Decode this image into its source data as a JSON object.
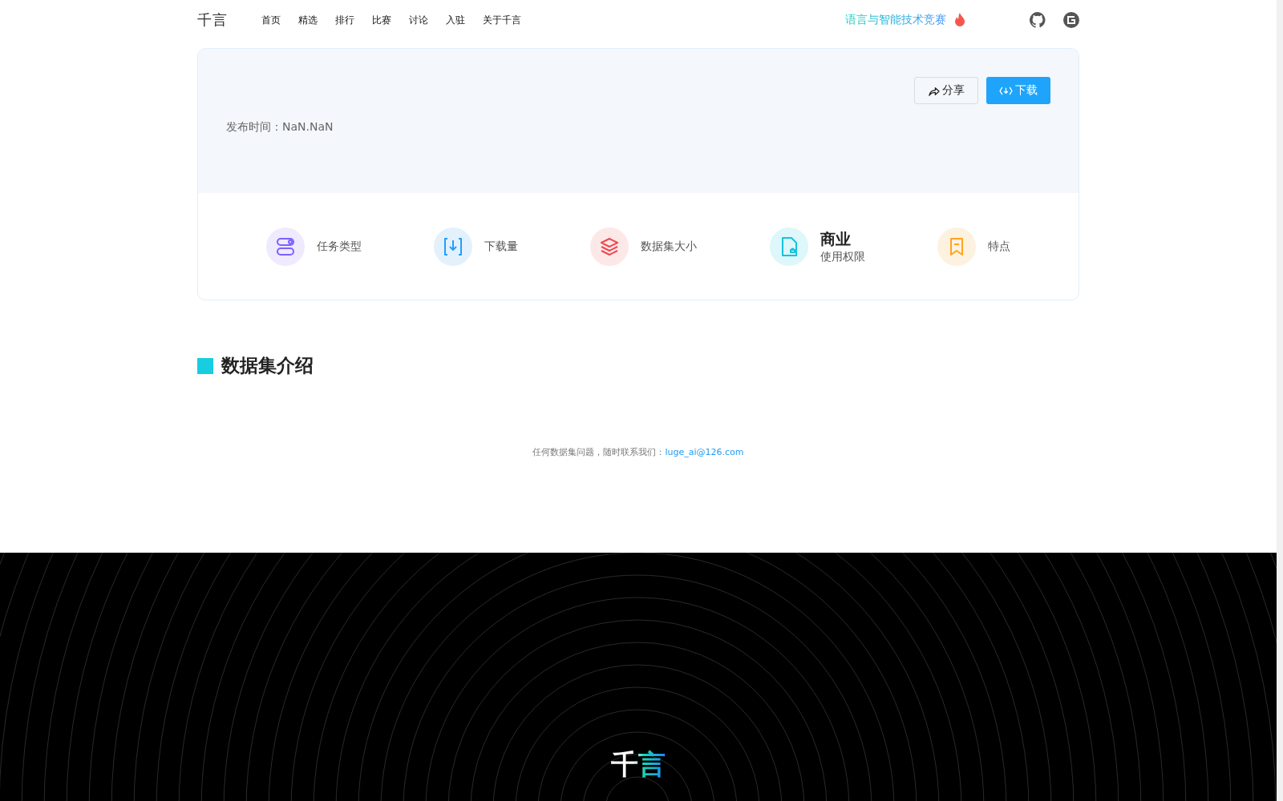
{
  "nav": {
    "logo": "千言",
    "links": [
      {
        "label": "首页"
      },
      {
        "label": "精选"
      },
      {
        "label": "排行"
      },
      {
        "label": "比赛"
      },
      {
        "label": "讨论"
      },
      {
        "label": "入驻"
      },
      {
        "label": "关于千言"
      }
    ],
    "promo": "语言与智能技术竞赛"
  },
  "header": {
    "publish": "发布时间：NaN.NaN",
    "buttons": [
      {
        "kind": "share",
        "label": "分享"
      },
      {
        "kind": "download",
        "label": "下载"
      }
    ]
  },
  "stats": [
    {
      "kind": "task",
      "label": "任务类型"
    },
    {
      "kind": "download",
      "label": "下载量"
    },
    {
      "kind": "size",
      "label": "数据集大小"
    },
    {
      "kind": "license",
      "title": "商业",
      "label": "使用权限"
    },
    {
      "kind": "feature",
      "label": "特点"
    }
  ],
  "section": {
    "title": "数据集介绍"
  },
  "contact": {
    "text": "任何数据集问题，随时联系我们：",
    "email": "luge_ai@126.com"
  },
  "footer": {
    "logo": "千言"
  }
}
